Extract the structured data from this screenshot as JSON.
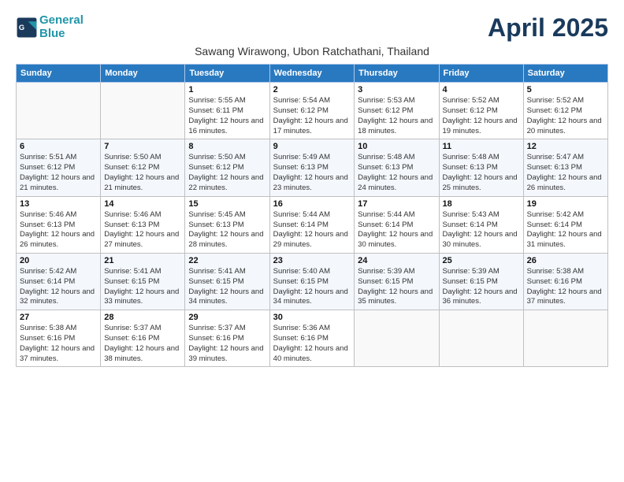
{
  "header": {
    "logo_general": "General",
    "logo_blue": "Blue",
    "month_title": "April 2025",
    "subtitle": "Sawang Wirawong, Ubon Ratchathani, Thailand"
  },
  "days_of_week": [
    "Sunday",
    "Monday",
    "Tuesday",
    "Wednesday",
    "Thursday",
    "Friday",
    "Saturday"
  ],
  "weeks": [
    [
      {
        "day": "",
        "info": ""
      },
      {
        "day": "",
        "info": ""
      },
      {
        "day": "1",
        "info": "Sunrise: 5:55 AM\nSunset: 6:11 PM\nDaylight: 12 hours and 16 minutes."
      },
      {
        "day": "2",
        "info": "Sunrise: 5:54 AM\nSunset: 6:12 PM\nDaylight: 12 hours and 17 minutes."
      },
      {
        "day": "3",
        "info": "Sunrise: 5:53 AM\nSunset: 6:12 PM\nDaylight: 12 hours and 18 minutes."
      },
      {
        "day": "4",
        "info": "Sunrise: 5:52 AM\nSunset: 6:12 PM\nDaylight: 12 hours and 19 minutes."
      },
      {
        "day": "5",
        "info": "Sunrise: 5:52 AM\nSunset: 6:12 PM\nDaylight: 12 hours and 20 minutes."
      }
    ],
    [
      {
        "day": "6",
        "info": "Sunrise: 5:51 AM\nSunset: 6:12 PM\nDaylight: 12 hours and 21 minutes."
      },
      {
        "day": "7",
        "info": "Sunrise: 5:50 AM\nSunset: 6:12 PM\nDaylight: 12 hours and 21 minutes."
      },
      {
        "day": "8",
        "info": "Sunrise: 5:50 AM\nSunset: 6:12 PM\nDaylight: 12 hours and 22 minutes."
      },
      {
        "day": "9",
        "info": "Sunrise: 5:49 AM\nSunset: 6:13 PM\nDaylight: 12 hours and 23 minutes."
      },
      {
        "day": "10",
        "info": "Sunrise: 5:48 AM\nSunset: 6:13 PM\nDaylight: 12 hours and 24 minutes."
      },
      {
        "day": "11",
        "info": "Sunrise: 5:48 AM\nSunset: 6:13 PM\nDaylight: 12 hours and 25 minutes."
      },
      {
        "day": "12",
        "info": "Sunrise: 5:47 AM\nSunset: 6:13 PM\nDaylight: 12 hours and 26 minutes."
      }
    ],
    [
      {
        "day": "13",
        "info": "Sunrise: 5:46 AM\nSunset: 6:13 PM\nDaylight: 12 hours and 26 minutes."
      },
      {
        "day": "14",
        "info": "Sunrise: 5:46 AM\nSunset: 6:13 PM\nDaylight: 12 hours and 27 minutes."
      },
      {
        "day": "15",
        "info": "Sunrise: 5:45 AM\nSunset: 6:13 PM\nDaylight: 12 hours and 28 minutes."
      },
      {
        "day": "16",
        "info": "Sunrise: 5:44 AM\nSunset: 6:14 PM\nDaylight: 12 hours and 29 minutes."
      },
      {
        "day": "17",
        "info": "Sunrise: 5:44 AM\nSunset: 6:14 PM\nDaylight: 12 hours and 30 minutes."
      },
      {
        "day": "18",
        "info": "Sunrise: 5:43 AM\nSunset: 6:14 PM\nDaylight: 12 hours and 30 minutes."
      },
      {
        "day": "19",
        "info": "Sunrise: 5:42 AM\nSunset: 6:14 PM\nDaylight: 12 hours and 31 minutes."
      }
    ],
    [
      {
        "day": "20",
        "info": "Sunrise: 5:42 AM\nSunset: 6:14 PM\nDaylight: 12 hours and 32 minutes."
      },
      {
        "day": "21",
        "info": "Sunrise: 5:41 AM\nSunset: 6:15 PM\nDaylight: 12 hours and 33 minutes."
      },
      {
        "day": "22",
        "info": "Sunrise: 5:41 AM\nSunset: 6:15 PM\nDaylight: 12 hours and 34 minutes."
      },
      {
        "day": "23",
        "info": "Sunrise: 5:40 AM\nSunset: 6:15 PM\nDaylight: 12 hours and 34 minutes."
      },
      {
        "day": "24",
        "info": "Sunrise: 5:39 AM\nSunset: 6:15 PM\nDaylight: 12 hours and 35 minutes."
      },
      {
        "day": "25",
        "info": "Sunrise: 5:39 AM\nSunset: 6:15 PM\nDaylight: 12 hours and 36 minutes."
      },
      {
        "day": "26",
        "info": "Sunrise: 5:38 AM\nSunset: 6:16 PM\nDaylight: 12 hours and 37 minutes."
      }
    ],
    [
      {
        "day": "27",
        "info": "Sunrise: 5:38 AM\nSunset: 6:16 PM\nDaylight: 12 hours and 37 minutes."
      },
      {
        "day": "28",
        "info": "Sunrise: 5:37 AM\nSunset: 6:16 PM\nDaylight: 12 hours and 38 minutes."
      },
      {
        "day": "29",
        "info": "Sunrise: 5:37 AM\nSunset: 6:16 PM\nDaylight: 12 hours and 39 minutes."
      },
      {
        "day": "30",
        "info": "Sunrise: 5:36 AM\nSunset: 6:16 PM\nDaylight: 12 hours and 40 minutes."
      },
      {
        "day": "",
        "info": ""
      },
      {
        "day": "",
        "info": ""
      },
      {
        "day": "",
        "info": ""
      }
    ]
  ]
}
